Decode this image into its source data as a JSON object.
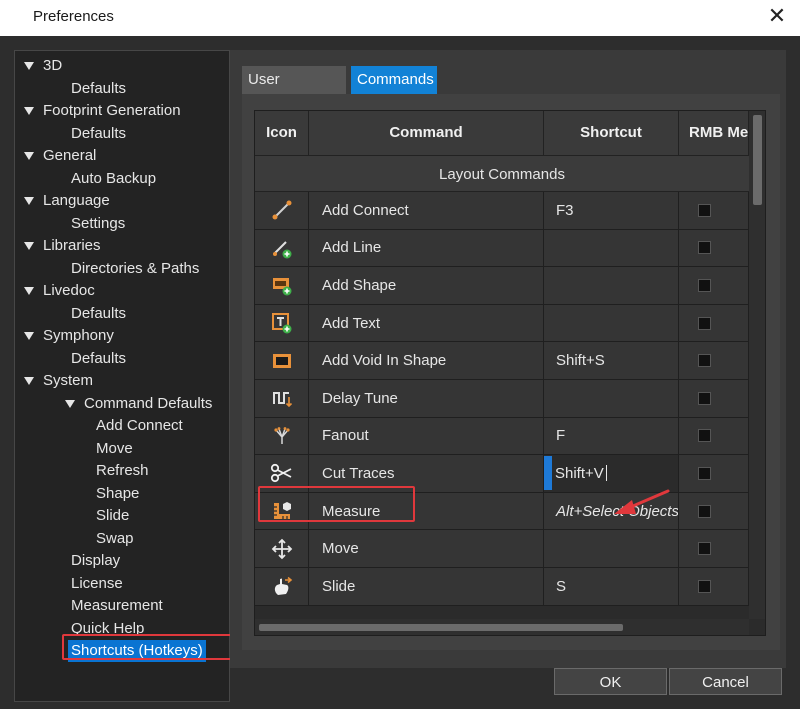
{
  "window": {
    "title": "Preferences",
    "close_glyph": "✕"
  },
  "tree": [
    {
      "label": "3D",
      "level": 0,
      "expanded": true
    },
    {
      "label": "Defaults",
      "level": 1
    },
    {
      "label": "Footprint Generation",
      "level": 0,
      "expanded": true
    },
    {
      "label": "Defaults",
      "level": 1
    },
    {
      "label": "General",
      "level": 0,
      "expanded": true
    },
    {
      "label": "Auto Backup",
      "level": 1
    },
    {
      "label": "Language",
      "level": 0,
      "expanded": true
    },
    {
      "label": "Settings",
      "level": 1
    },
    {
      "label": "Libraries",
      "level": 0,
      "expanded": true
    },
    {
      "label": "Directories & Paths",
      "level": 1
    },
    {
      "label": "Livedoc",
      "level": 0,
      "expanded": true
    },
    {
      "label": "Defaults",
      "level": 1
    },
    {
      "label": "Symphony",
      "level": 0,
      "expanded": true
    },
    {
      "label": "Defaults",
      "level": 1
    },
    {
      "label": "System",
      "level": 0,
      "expanded": true
    },
    {
      "label": "Command Defaults",
      "level": 1,
      "expanded": true
    },
    {
      "label": "Add Connect",
      "level": 2
    },
    {
      "label": "Move",
      "level": 2
    },
    {
      "label": "Refresh",
      "level": 2
    },
    {
      "label": "Shape",
      "level": 2
    },
    {
      "label": "Slide",
      "level": 2
    },
    {
      "label": "Swap",
      "level": 2
    },
    {
      "label": "Display",
      "level": 1
    },
    {
      "label": "License",
      "level": 1
    },
    {
      "label": "Measurement",
      "level": 1
    },
    {
      "label": "Quick Help",
      "level": 1
    },
    {
      "label": "Shortcuts (Hotkeys)",
      "level": 1,
      "selected": true
    }
  ],
  "tabs": {
    "user_interface": "User Interface",
    "commands": "Commands"
  },
  "table": {
    "columns": [
      "Icon",
      "Command",
      "Shortcut",
      "RMB Me"
    ],
    "group": "Layout Commands",
    "rows": [
      {
        "icon": "add-connect-icon",
        "command": "Add Connect",
        "shortcut": "F3"
      },
      {
        "icon": "add-line-icon",
        "command": "Add Line",
        "shortcut": ""
      },
      {
        "icon": "add-shape-icon",
        "command": "Add Shape",
        "shortcut": ""
      },
      {
        "icon": "add-text-icon",
        "command": "Add Text",
        "shortcut": ""
      },
      {
        "icon": "add-void-icon",
        "command": "Add Void In Shape",
        "shortcut": "Shift+S"
      },
      {
        "icon": "delay-tune-icon",
        "command": "Delay Tune",
        "shortcut": ""
      },
      {
        "icon": "fanout-icon",
        "command": "Fanout",
        "shortcut": "F"
      },
      {
        "icon": "scissors-icon",
        "command": "Cut Traces",
        "shortcut": "Shift+V",
        "editing": true
      },
      {
        "icon": "measure-icon",
        "command": "Measure",
        "shortcut": "Alt+Select Objects",
        "italic": true
      },
      {
        "icon": "move-icon",
        "command": "Move",
        "shortcut": ""
      },
      {
        "icon": "slide-icon",
        "command": "Slide",
        "shortcut": "S"
      }
    ]
  },
  "buttons": {
    "ok": "OK",
    "cancel": "Cancel"
  },
  "colors": {
    "accent": "#1282d6",
    "highlight_box": "#e0383c",
    "icon_orange": "#e8913a",
    "icon_green": "#3fb04a"
  }
}
